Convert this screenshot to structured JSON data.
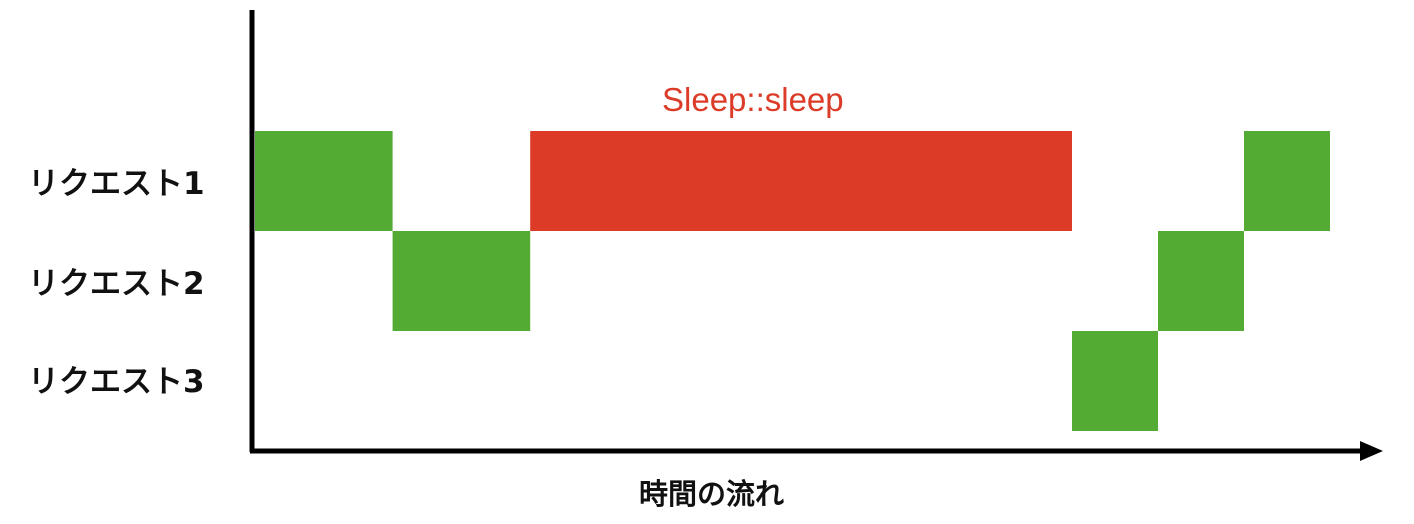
{
  "colors": {
    "processing": "#54ab33",
    "sleep": "#db3b27",
    "axis": "#000000",
    "text": "#111111"
  },
  "rows": [
    {
      "label": "リクエスト1"
    },
    {
      "label": "リクエスト2"
    },
    {
      "label": "リクエスト3"
    }
  ],
  "annotation": {
    "text": "Sleep::sleep"
  },
  "x_axis": {
    "label": "時間の流れ"
  },
  "chart_data": {
    "type": "timeline",
    "xlabel": "時間の流れ",
    "categories": [
      "リクエスト1",
      "リクエスト2",
      "リクエスト3"
    ],
    "segments": [
      {
        "row": 0,
        "start": 0,
        "end": 1.6,
        "kind": "processing"
      },
      {
        "row": 1,
        "start": 1.6,
        "end": 3.2,
        "kind": "processing"
      },
      {
        "row": 0,
        "start": 3.2,
        "end": 9.5,
        "kind": "sleep",
        "label": "Sleep::sleep"
      },
      {
        "row": 2,
        "start": 9.5,
        "end": 10.5,
        "kind": "processing"
      },
      {
        "row": 1,
        "start": 10.5,
        "end": 11.5,
        "kind": "processing"
      },
      {
        "row": 0,
        "start": 11.5,
        "end": 12.5,
        "kind": "processing"
      }
    ]
  }
}
